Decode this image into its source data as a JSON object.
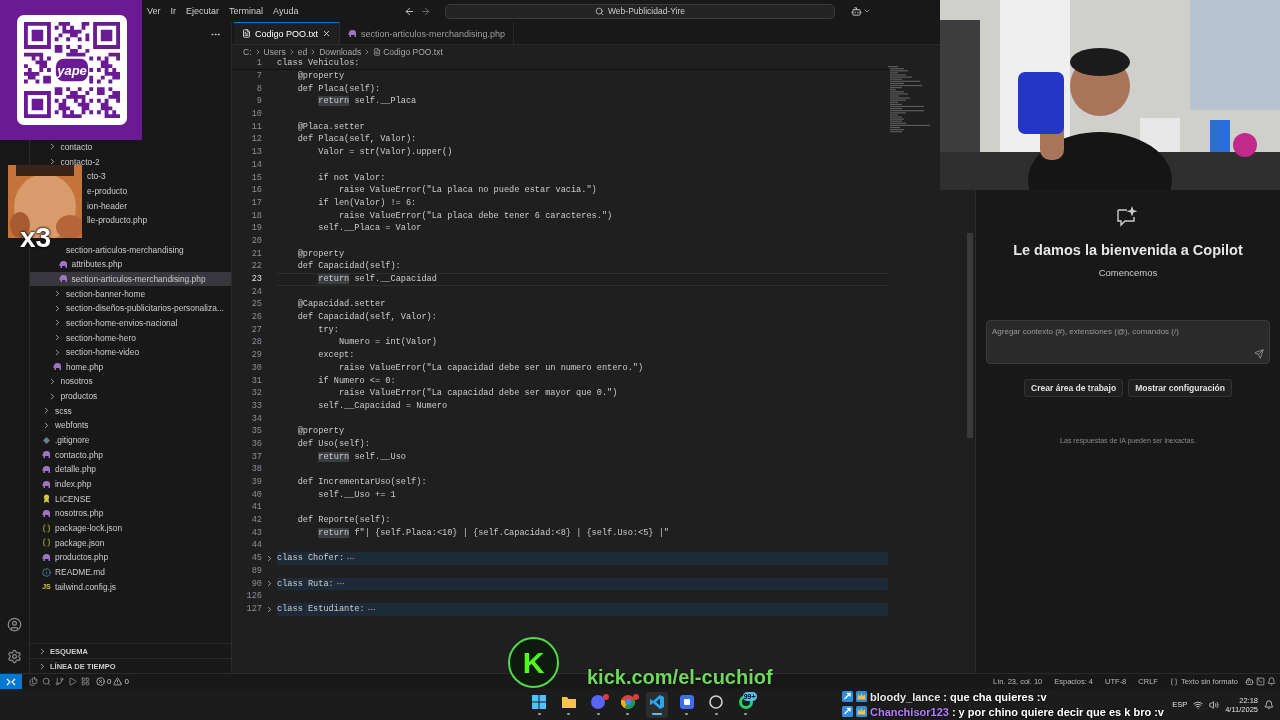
{
  "overlays": {
    "qr": {
      "logo_text": "yape"
    },
    "emote": {
      "kind": "picture",
      "multiplier": "x3"
    },
    "stream_link": {
      "logo_letter": "K",
      "url": "kick.com/el-cuchiof"
    },
    "chat": [
      {
        "user": "bloody_lance",
        "color": "#e8e8e8",
        "message": ": que cha quieres :v"
      },
      {
        "user": "Chanchisor123",
        "color": "#b57cff",
        "message": ": y por chino quiere decir que es k bro :v"
      }
    ]
  },
  "title_bar": {
    "menus": [
      "Ver",
      "Ir",
      "Ejecutar",
      "Terminal",
      "Ayuda"
    ],
    "search": "Web-Publicidad-Yire"
  },
  "explorer": {
    "items": [
      {
        "children": [
          {
            "label": "contacto",
            "kind": "folder",
            "expanded": false,
            "selected": false
          },
          {
            "label": "contacto-2",
            "kind": "folder",
            "expanded": false,
            "selected": false
          },
          {
            "label": "cto-3",
            "kind": "clipped",
            "selected": false
          },
          {
            "label": "e-producto",
            "kind": "clipped",
            "selected": false
          },
          {
            "label": "ion-header",
            "kind": "clipped",
            "selected": false
          },
          {
            "label": "lle-producto.php",
            "kind": "clipped",
            "selected": false
          },
          {
            "children": [
              {
                "label": "section-articulos-merchandising",
                "kind": "folder",
                "selected": false,
                "children": [
                  {
                    "label": "attributes.php",
                    "kind": "php",
                    "selected": false
                  },
                  {
                    "label": "section-articulos-merchandising.php",
                    "kind": "php",
                    "selected": true
                  }
                ]
              },
              {
                "label": "section-banner-home",
                "kind": "folder",
                "expanded": false,
                "selected": false
              },
              {
                "label": "section-diseños-publicitarios-personaliza...",
                "kind": "folder",
                "expanded": false,
                "selected": false
              },
              {
                "label": "section-home-envios-nacional",
                "kind": "folder",
                "expanded": false,
                "selected": false
              },
              {
                "label": "section-home-hero",
                "kind": "folder",
                "expanded": false,
                "selected": false
              },
              {
                "label": "section-home-video",
                "kind": "folder",
                "expanded": false,
                "selected": false
              },
              {
                "label": "home.php",
                "kind": "php",
                "selected": false
              }
            ]
          },
          {
            "label": "nosotros",
            "kind": "folder",
            "expanded": false,
            "selected": false
          },
          {
            "label": "productos",
            "kind": "folder",
            "expanded": false,
            "selected": false
          }
        ]
      },
      {
        "label": "scss",
        "kind": "folder",
        "expanded": false,
        "selected": false
      },
      {
        "label": "webfonts",
        "kind": "folder",
        "expanded": false,
        "selected": false
      },
      {
        "label": ".gitignore",
        "kind": "git",
        "selected": false
      },
      {
        "label": "contacto.php",
        "kind": "php",
        "selected": false
      },
      {
        "label": "detalle.php",
        "kind": "php",
        "selected": false
      },
      {
        "label": "index.php",
        "kind": "php",
        "selected": false
      },
      {
        "label": "LICENSE",
        "kind": "license",
        "selected": false
      },
      {
        "label": "nosotros.php",
        "kind": "php",
        "selected": false
      },
      {
        "label": "package-lock.json",
        "kind": "json",
        "selected": false
      },
      {
        "label": "package.json",
        "kind": "json",
        "selected": false
      },
      {
        "label": "productos.php",
        "kind": "php",
        "selected": false
      },
      {
        "label": "README.md",
        "kind": "readme",
        "selected": false
      },
      {
        "label": "tailwind.config.js",
        "kind": "js",
        "icon_text": "JS",
        "selected": false
      }
    ],
    "sections": [
      {
        "label": "ESQUEMA",
        "expanded": false
      },
      {
        "label": "LÍNEA DE TIEMPO",
        "expanded": false
      }
    ]
  },
  "editor": {
    "tabs": [
      {
        "label": "Codigo POO.txt",
        "kind": "text",
        "selected": true
      },
      {
        "label": "section-articulos-merchandising.php",
        "kind": "php",
        "selected": false
      }
    ],
    "breadcrumbs": [
      "C:",
      "Users",
      "ed",
      "Downloads",
      "Codigo POO.txt"
    ],
    "sticky": {
      "n": "1",
      "text": "class Vehiculos:"
    },
    "lines": [
      {
        "n": "7",
        "kind": "code",
        "current": false,
        "text": "    @property"
      },
      {
        "n": "8",
        "kind": "code",
        "current": false,
        "text": "    def Placa(self):"
      },
      {
        "n": "9",
        "kind": "code",
        "current": false,
        "word_highlighted": true,
        "text": "        return self.__Placa"
      },
      {
        "n": "10",
        "kind": "code",
        "current": false
      },
      {
        "n": "11",
        "kind": "code",
        "current": false,
        "text": "    @Placa.setter"
      },
      {
        "n": "12",
        "kind": "code",
        "current": false,
        "text": "    def Placa(self, Valor):"
      },
      {
        "n": "13",
        "kind": "code",
        "current": false,
        "text": "        Valor = str(Valor).upper()"
      },
      {
        "n": "14",
        "kind": "code",
        "current": false
      },
      {
        "n": "15",
        "kind": "code",
        "current": false,
        "text": "        if not Valor:"
      },
      {
        "n": "16",
        "kind": "code",
        "current": false,
        "text": "            raise ValueError(\"La placa no puede estar vacia.\")"
      },
      {
        "n": "17",
        "kind": "code",
        "current": false,
        "text": "        if len(Valor) != 6:"
      },
      {
        "n": "18",
        "kind": "code",
        "current": false,
        "text": "            raise ValueError(\"La placa debe tener 6 caracteres.\")"
      },
      {
        "n": "19",
        "kind": "code",
        "current": false,
        "text": "        self.__Placa = Valor"
      },
      {
        "n": "20",
        "kind": "code",
        "current": false
      },
      {
        "n": "21",
        "kind": "code",
        "current": false,
        "text": "    @property"
      },
      {
        "n": "22",
        "kind": "code",
        "current": false,
        "text": "    def Capacidad(self):"
      },
      {
        "n": "23",
        "kind": "code",
        "current": true,
        "word_highlighted": true,
        "text": "        return self.__Capacidad"
      },
      {
        "n": "24",
        "kind": "code",
        "current": false
      },
      {
        "n": "25",
        "kind": "code",
        "current": false,
        "text": "    @Capacidad.setter"
      },
      {
        "n": "26",
        "kind": "code",
        "current": false,
        "text": "    def Capacidad(self, Valor):"
      },
      {
        "n": "27",
        "kind": "code",
        "current": false,
        "text": "        try:"
      },
      {
        "n": "28",
        "kind": "code",
        "current": false,
        "text": "            Numero = int(Valor)"
      },
      {
        "n": "29",
        "kind": "code",
        "current": false,
        "text": "        except:"
      },
      {
        "n": "30",
        "kind": "code",
        "current": false,
        "text": "            raise ValueError(\"La capacidad debe ser un numero entero.\")"
      },
      {
        "n": "31",
        "kind": "code",
        "current": false,
        "text": "        if Numero <= 0:"
      },
      {
        "n": "32",
        "kind": "code",
        "current": false,
        "text": "            raise ValueError(\"La capacidad debe ser mayor que 0.\")"
      },
      {
        "n": "33",
        "kind": "code",
        "current": false,
        "text": "        self.__Capacidad = Numero"
      },
      {
        "n": "34",
        "kind": "code",
        "current": false
      },
      {
        "n": "35",
        "kind": "code",
        "current": false,
        "text": "    @property"
      },
      {
        "n": "36",
        "kind": "code",
        "current": false,
        "text": "    def Uso(self):"
      },
      {
        "n": "37",
        "kind": "code",
        "current": false,
        "word_highlighted": true,
        "text": "        return self.__Uso"
      },
      {
        "n": "38",
        "kind": "code",
        "current": false
      },
      {
        "n": "39",
        "kind": "code",
        "current": false,
        "text": "    def IncrementarUso(self):"
      },
      {
        "n": "40",
        "kind": "code",
        "current": false,
        "text": "        self.__Uso += 1"
      },
      {
        "n": "41",
        "kind": "code",
        "current": false
      },
      {
        "n": "42",
        "kind": "code",
        "current": false,
        "text": "    def Reporte(self):"
      },
      {
        "n": "43",
        "kind": "code",
        "current": false,
        "word_highlighted": true,
        "text": "        return f\"| {self.Placa:<10} | {self.Capacidad:<8} | {self.Uso:<5} |\""
      },
      {
        "n": "44",
        "kind": "code",
        "current": false
      },
      {
        "n": "45",
        "kind": "fold",
        "folded": true,
        "current": false,
        "text": "class Chofer:"
      },
      {
        "n": "89",
        "kind": "code",
        "current": false
      },
      {
        "n": "90",
        "kind": "fold",
        "folded": true,
        "current": false,
        "text": "class Ruta:"
      },
      {
        "n": "126",
        "kind": "code",
        "current": false
      },
      {
        "n": "127",
        "kind": "fold",
        "folded": true,
        "current": false,
        "text": "class Estudiante:"
      }
    ]
  },
  "copilot": {
    "title": "Le damos la bienvenida a Copilot",
    "subtitle": "Comencemos",
    "input": {
      "placeholder": "Agregar contexto (#), extensiones (@), comandos (/)"
    },
    "buttons": [
      "Crear área de trabajo",
      "Mostrar configuración"
    ],
    "disclaimer": "Las respuestas de IA pueden ser inexactas."
  },
  "status_bar": {
    "problems": {
      "errors": "0",
      "warnings": "0"
    },
    "items": [
      {
        "text": "Lín. 23, col. 10",
        "kind": "plain"
      },
      {
        "text": "Espacios: 4",
        "kind": "plain"
      },
      {
        "text": "UTF-8",
        "kind": "plain"
      },
      {
        "text": "CRLF",
        "kind": "plain"
      },
      {
        "text": "Texto sin formato",
        "kind": "language"
      }
    ]
  },
  "taskbar": {
    "apps": [
      {
        "kind": "windows",
        "selected": false,
        "notified": false
      },
      {
        "kind": "files",
        "selected": false,
        "notified": false
      },
      {
        "kind": "discord",
        "selected": false,
        "notified": true
      },
      {
        "kind": "chrome",
        "selected": false,
        "notified": true
      },
      {
        "kind": "vscode",
        "selected": true,
        "notified": false
      },
      {
        "kind": "square",
        "selected": false,
        "notified": false
      },
      {
        "kind": "ring",
        "selected": false,
        "notified": false
      },
      {
        "kind": "whatsapp",
        "selected": false,
        "notified": false,
        "badge": "99+"
      }
    ],
    "language": "ESP",
    "time": "22:18",
    "date": "4/11/2025"
  }
}
